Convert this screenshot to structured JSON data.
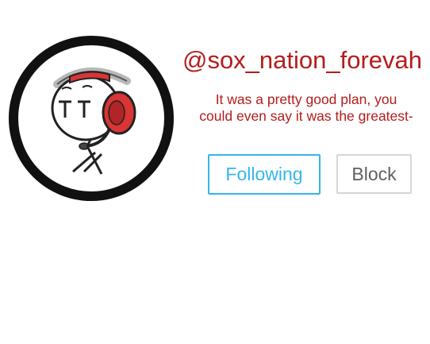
{
  "profile": {
    "username": "@sox_nation_forevah",
    "bio_line1": "It was a pretty good plan, you",
    "bio_line2": "could even say it was the greatest-",
    "avatar_icon": "stickman-with-headset-avatar"
  },
  "actions": {
    "following_label": "Following",
    "block_label": "Block"
  },
  "colors": {
    "username_text": "#b51c1c",
    "following_accent": "#35b6ea",
    "block_border": "#d6d6d6",
    "block_text": "#606060",
    "avatar_ring": "#111111",
    "headset_red": "#d93535"
  }
}
